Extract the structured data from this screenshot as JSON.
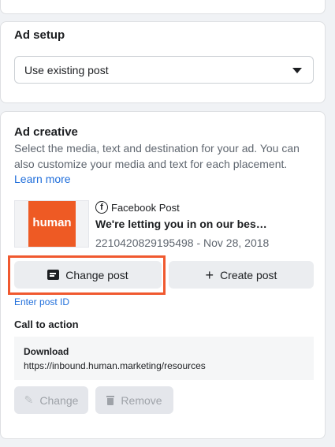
{
  "ad_setup": {
    "title": "Ad setup",
    "select_value": "Use existing post"
  },
  "ad_creative": {
    "title": "Ad creative",
    "description": "Select the media, text and destination for your ad. You can also customize your media and text for each placement.",
    "learn_more": "Learn more",
    "post": {
      "thumbnail_text": "human",
      "source_label": "Facebook Post",
      "title": "We're letting you in on our bes…",
      "meta": "2210420829195498 - Nov 28, 2018"
    },
    "buttons": {
      "change_post": "Change post",
      "create_post": "Create post"
    },
    "enter_post_id": "Enter post ID",
    "cta": {
      "title": "Call to action",
      "name": "Download",
      "url": "https://inbound.human.marketing/resources",
      "change_label": "Change",
      "remove_label": "Remove"
    }
  },
  "colors": {
    "accent": "#216fdb",
    "highlight": "#f0592f",
    "thumbnail": "#ee5a24"
  },
  "icons": [
    "chevron-down-icon",
    "facebook-icon",
    "post-icon",
    "plus-icon",
    "pencil-icon",
    "trash-icon"
  ]
}
